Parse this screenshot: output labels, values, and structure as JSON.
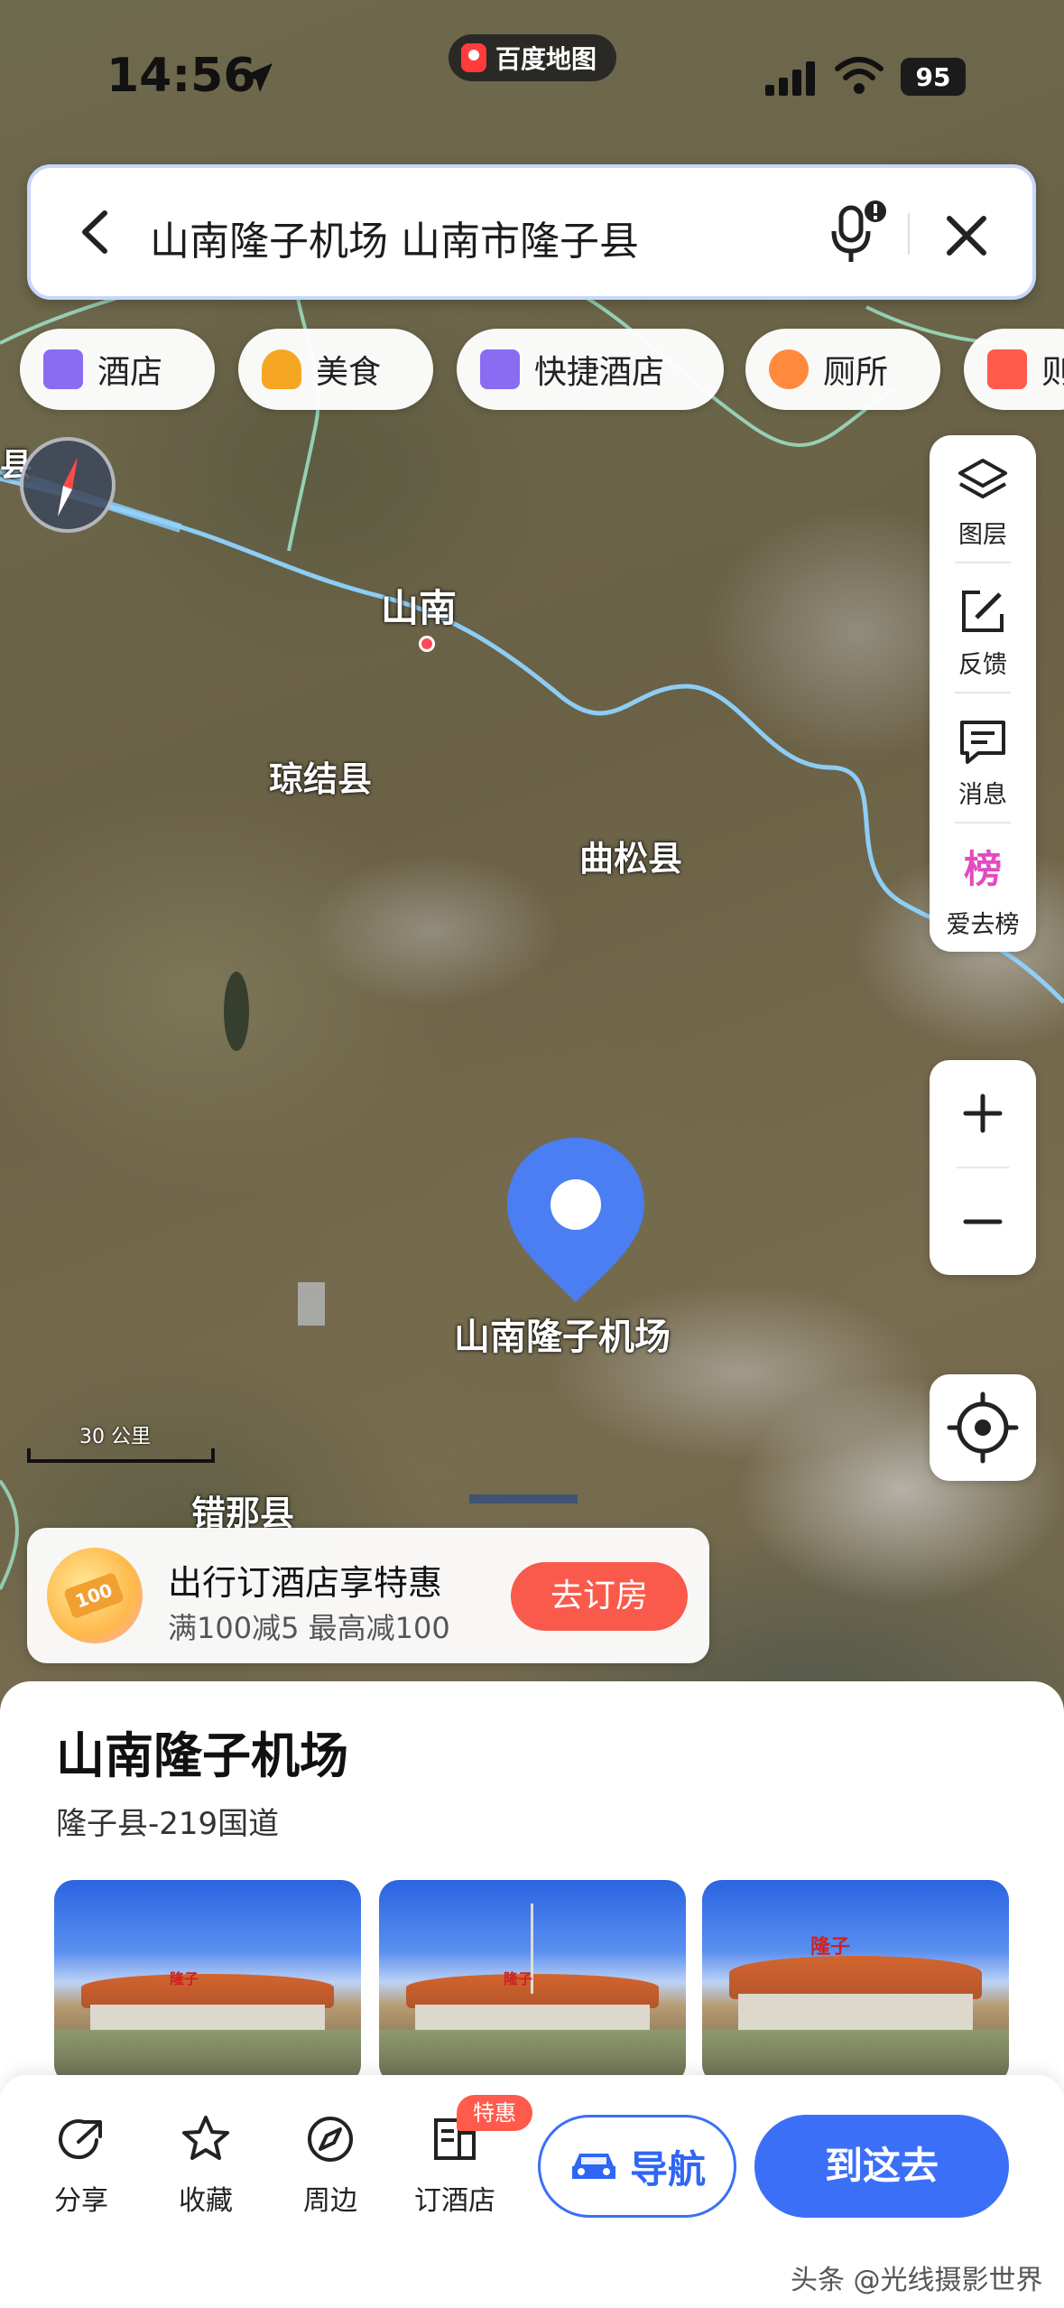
{
  "status_bar": {
    "time": "14:56",
    "battery": "95",
    "app_name": "百度地图"
  },
  "search": {
    "query": "山南隆子机场 山南市隆子县"
  },
  "categories": [
    {
      "label": "酒店",
      "icon": "hotel-icon",
      "color": "#8a6cf2"
    },
    {
      "label": "美食",
      "icon": "food-icon",
      "color": "#f5a623"
    },
    {
      "label": "快捷酒店",
      "icon": "budget-hotel-icon",
      "color": "#8a6cf2"
    },
    {
      "label": "厕所",
      "icon": "toilet-icon",
      "color": "#ff8a3d"
    },
    {
      "label": "则",
      "icon": "shopping-icon",
      "color": "#ff5a4b"
    }
  ],
  "map": {
    "labels": {
      "city": "山南",
      "county_1": "琼结县",
      "county_2": "曲松县",
      "county_3": "错那县",
      "poi": "山南隆子机场",
      "left_edge": "县"
    },
    "scale": "30 公里"
  },
  "tools": [
    {
      "label": "图层",
      "icon": "layers-icon"
    },
    {
      "label": "反馈",
      "icon": "feedback-icon"
    },
    {
      "label": "消息",
      "icon": "message-icon"
    },
    {
      "label": "爱去榜",
      "icon": "ranking-icon",
      "badge": "榜"
    }
  ],
  "zoom": {
    "in": "+",
    "out": "−"
  },
  "promo": {
    "title": "出行订酒店享特惠",
    "subtitle": "满100减5 最高减100",
    "button": "去订房",
    "badge": "100"
  },
  "place": {
    "name": "山南隆子机场",
    "address": "隆子县-219国道",
    "photo_signs": [
      "隆子",
      "隆子",
      "隆子"
    ]
  },
  "actions": [
    {
      "label": "分享",
      "icon": "share-icon"
    },
    {
      "label": "收藏",
      "icon": "star-icon"
    },
    {
      "label": "周边",
      "icon": "compass-icon"
    },
    {
      "label": "订酒店",
      "icon": "hotel-book-icon"
    }
  ],
  "hotel_tag": "特惠",
  "navigate": "导航",
  "go_here": "到这去",
  "watermark": "头条 @光线摄影世界",
  "colors": {
    "primary": "#3b6ff7",
    "accent_red": "#fa5a4b",
    "river": "#8fd3ff"
  }
}
